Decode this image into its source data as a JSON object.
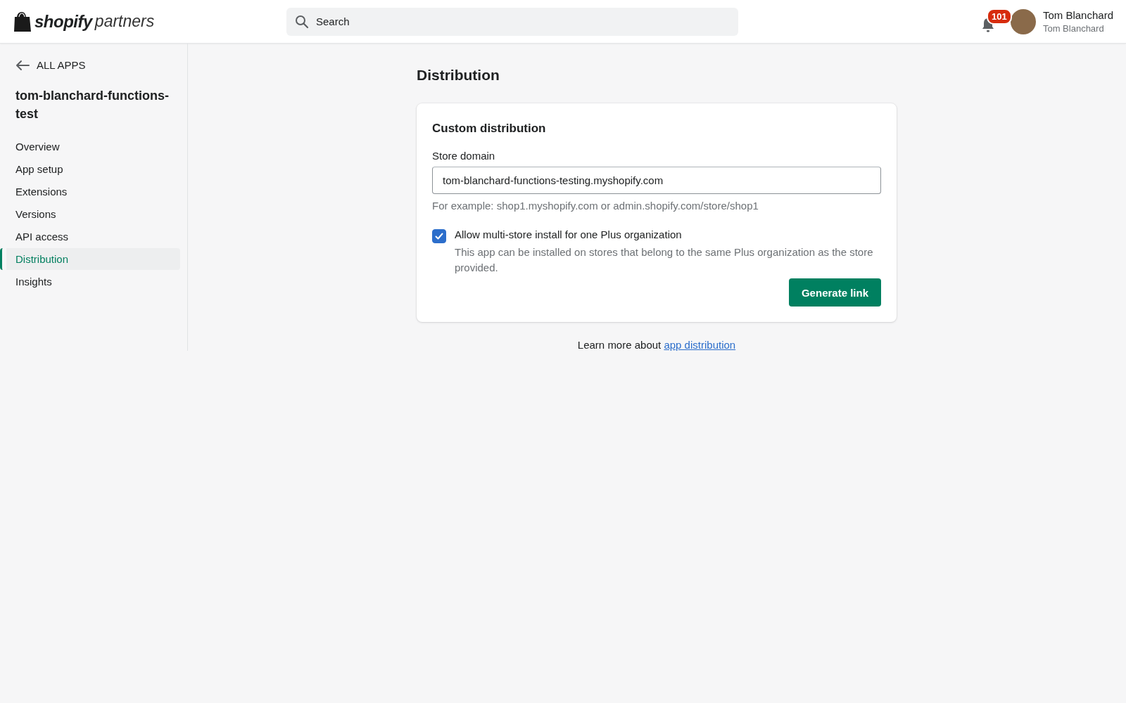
{
  "header": {
    "logo": {
      "brand": "shopify",
      "product": "partners"
    },
    "search": {
      "placeholder": "Search"
    },
    "notifications": {
      "count": "101"
    },
    "user": {
      "name": "Tom Blanchard",
      "subtitle": "Tom Blanchard"
    }
  },
  "sidebar": {
    "back_link": "ALL APPS",
    "app_name": "tom-blanchard-functions-test",
    "items": [
      {
        "label": "Overview",
        "selected": false
      },
      {
        "label": "App setup",
        "selected": false
      },
      {
        "label": "Extensions",
        "selected": false
      },
      {
        "label": "Versions",
        "selected": false
      },
      {
        "label": "API access",
        "selected": false
      },
      {
        "label": "Distribution",
        "selected": true
      },
      {
        "label": "Insights",
        "selected": false
      }
    ]
  },
  "page": {
    "title": "Distribution",
    "card": {
      "title": "Custom distribution",
      "field": {
        "label": "Store domain",
        "value": "tom-blanchard-functions-testing.myshopify.com",
        "help": "For example: shop1.myshopify.com or admin.shopify.com/store/shop1"
      },
      "checkbox": {
        "label": "Allow multi-store install for one Plus organization",
        "description": "This app can be installed on stores that belong to the same Plus organization as the store provided.",
        "checked": true
      },
      "button": "Generate link"
    },
    "footer": {
      "text": "Learn more about",
      "link": "app distribution"
    }
  }
}
